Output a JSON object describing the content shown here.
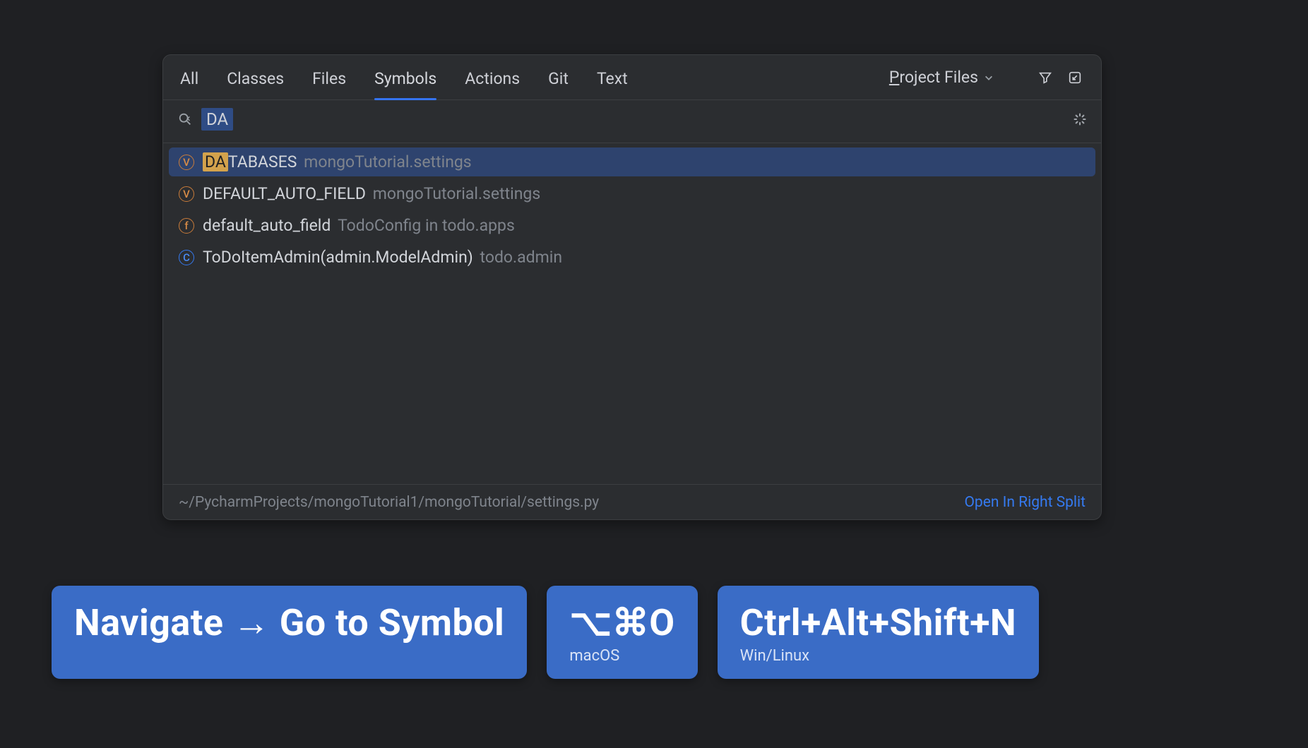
{
  "popup": {
    "tabs": [
      {
        "label": "All"
      },
      {
        "label": "Classes"
      },
      {
        "label": "Files"
      },
      {
        "label": "Symbols"
      },
      {
        "label": "Actions"
      },
      {
        "label": "Git"
      },
      {
        "label": "Text"
      }
    ],
    "active_tab": "Symbols",
    "scope_prefix": "P",
    "scope_rest": "roject Files",
    "search_query": "DA",
    "results": [
      {
        "kind": "v",
        "kind_letter": "V",
        "highlight": "DA",
        "name_rest": "TABASES",
        "ctx": "mongoTutorial.settings",
        "selected": true
      },
      {
        "kind": "v",
        "kind_letter": "V",
        "highlight": "",
        "name_rest": "DEFAULT_AUTO_FIELD",
        "ctx": "mongoTutorial.settings",
        "selected": false
      },
      {
        "kind": "f",
        "kind_letter": "f",
        "highlight": "",
        "name_rest": "default_auto_field",
        "ctx": "TodoConfig in todo.apps",
        "selected": false
      },
      {
        "kind": "c",
        "kind_letter": "C",
        "highlight": "",
        "name_rest": "ToDoItemAdmin(admin.ModelAdmin)",
        "ctx": "todo.admin",
        "selected": false
      }
    ],
    "status_path": "~/PycharmProjects/mongoTutorial1/mongoTutorial/settings.py",
    "open_split": "Open In Right Split"
  },
  "cards": {
    "menu": "Navigate → Go to Symbol",
    "mac_keys": "⌥⌘O",
    "mac_label": "macOS",
    "win_keys": "Ctrl+Alt+Shift+N",
    "win_label": "Win/Linux"
  }
}
